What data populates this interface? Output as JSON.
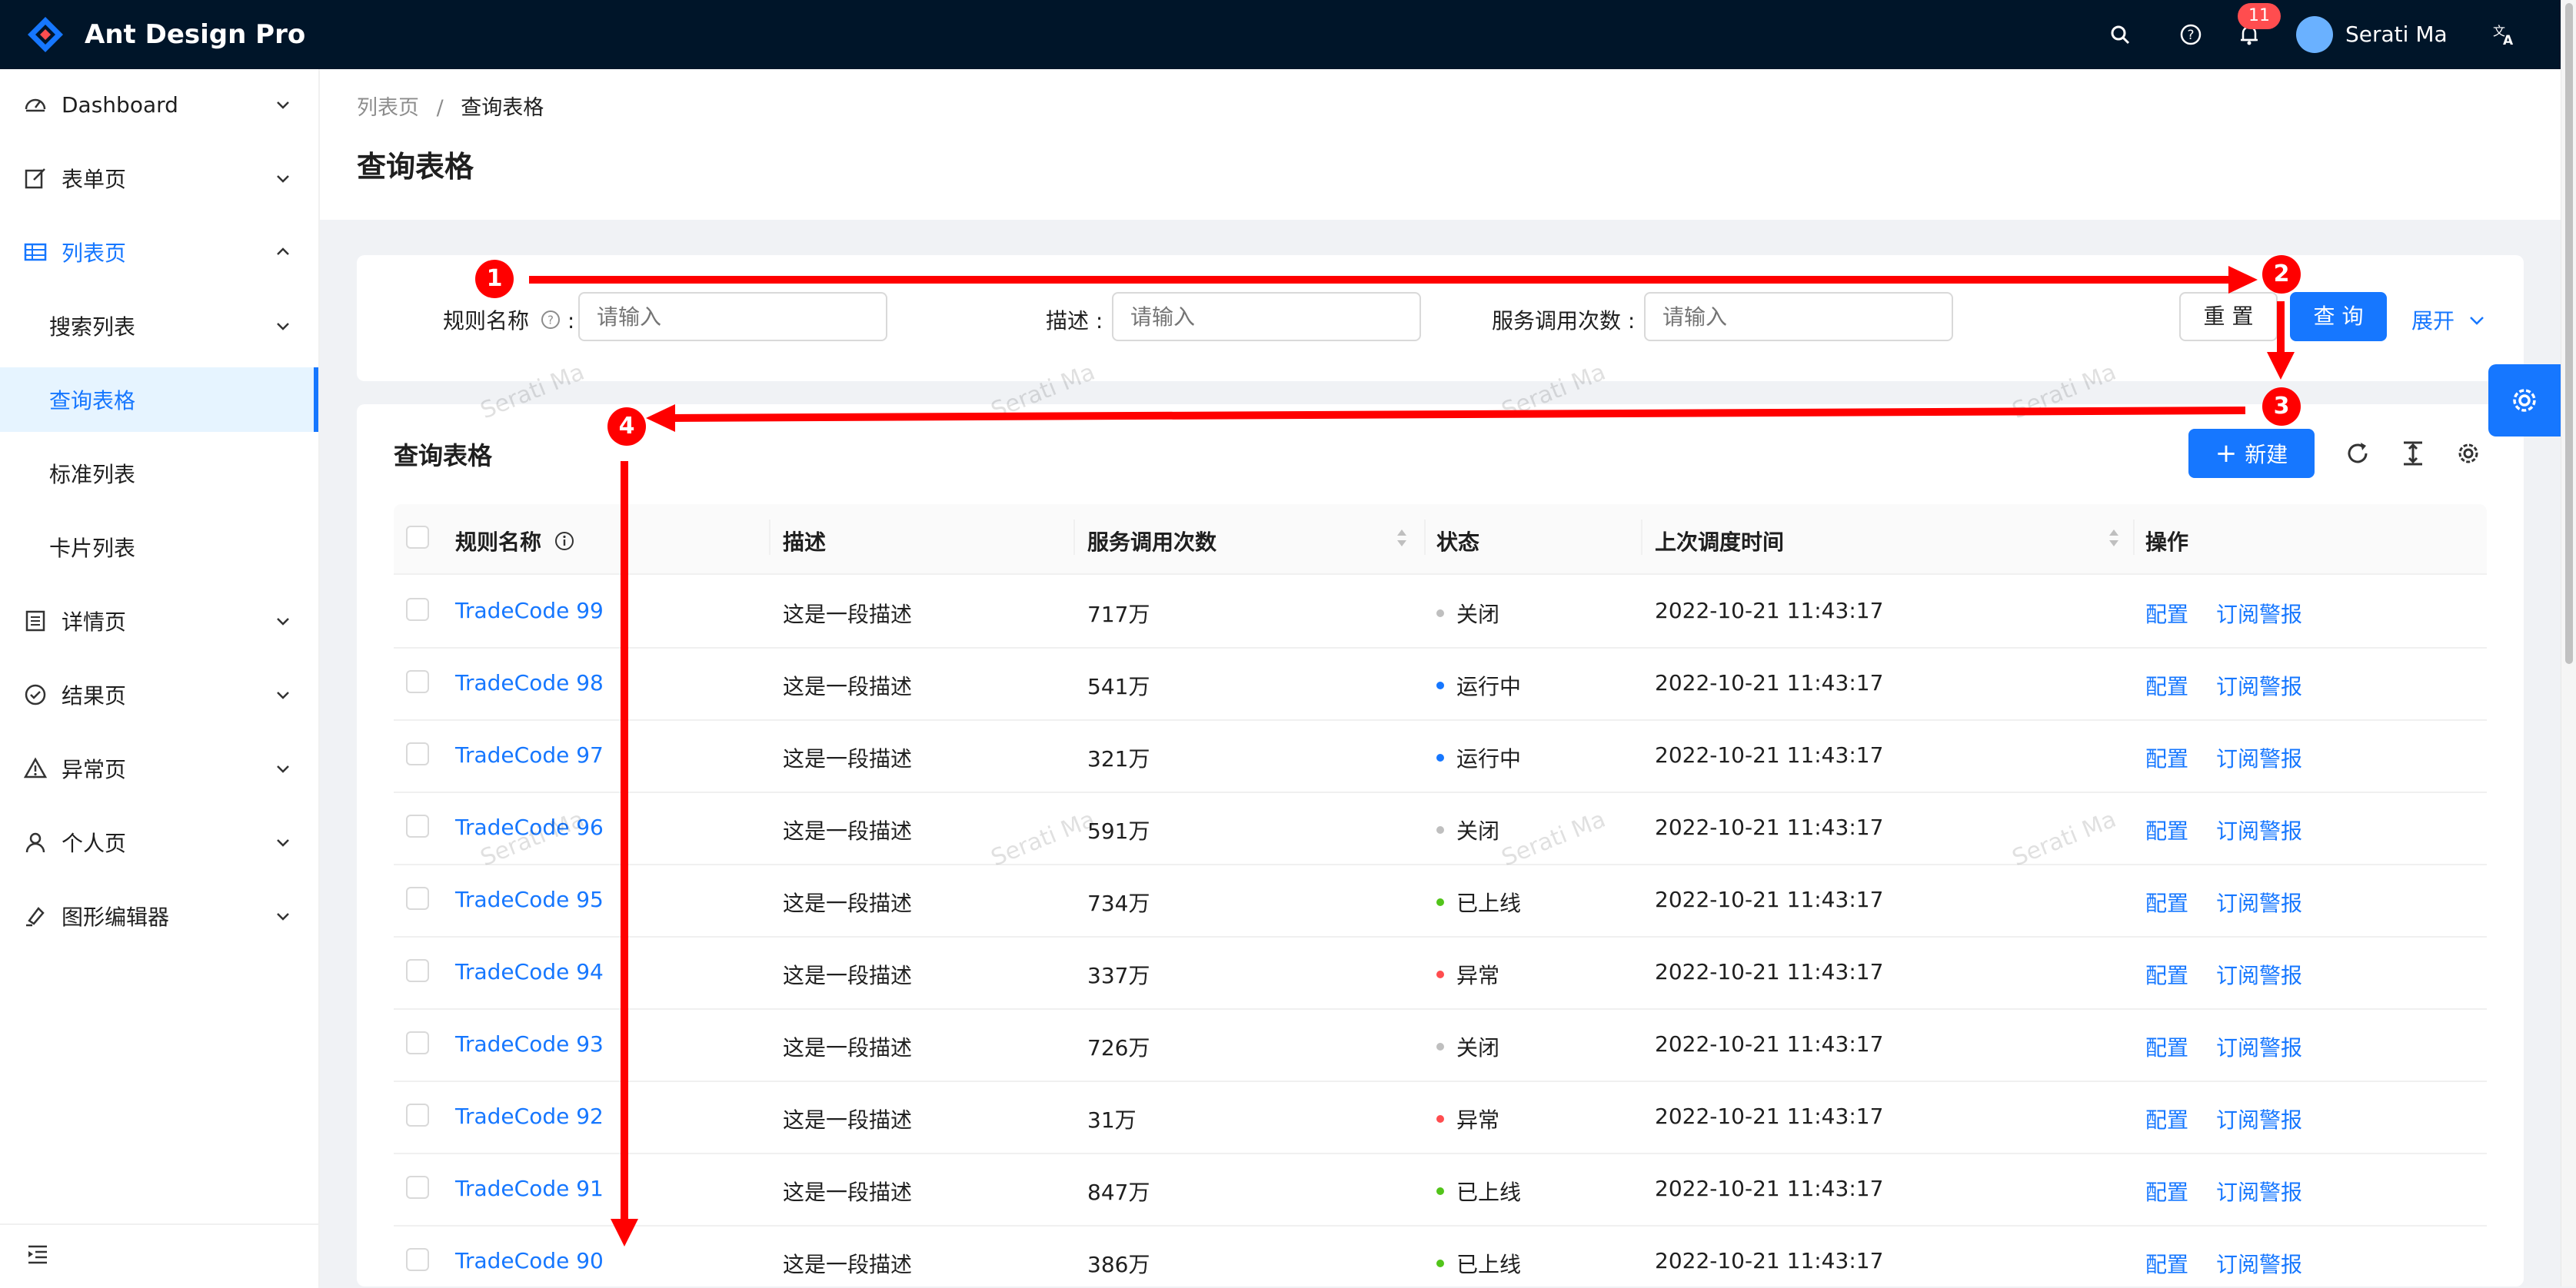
{
  "header": {
    "app_title": "Ant Design Pro",
    "notification_count": "11",
    "username": "Serati Ma",
    "icons": [
      "search-icon",
      "question-icon",
      "bell-icon",
      "translate-icon"
    ]
  },
  "sidebar": {
    "items": [
      {
        "label": "Dashboard",
        "icon": "dashboard-icon"
      },
      {
        "label": "表单页",
        "icon": "form-icon"
      },
      {
        "label": "列表页",
        "icon": "table-icon"
      },
      {
        "label": "搜索列表"
      },
      {
        "label": "查询表格"
      },
      {
        "label": "标准列表"
      },
      {
        "label": "卡片列表"
      },
      {
        "label": "详情页",
        "icon": "profile-icon"
      },
      {
        "label": "结果页",
        "icon": "check-circle-icon"
      },
      {
        "label": "异常页",
        "icon": "warning-icon"
      },
      {
        "label": "个人页",
        "icon": "user-icon"
      },
      {
        "label": "图形编辑器",
        "icon": "highlight-icon"
      }
    ]
  },
  "breadcrumb": {
    "parent": "列表页",
    "separator": "/",
    "current": "查询表格"
  },
  "page": {
    "title": "查询表格"
  },
  "search": {
    "rule_name_label": "规则名称",
    "rule_name_colon": ":",
    "desc_label": "描述",
    "desc_colon": ":",
    "calls_label": "服务调用次数",
    "calls_colon": ":",
    "placeholder": "请输入",
    "reset_label": "重 置",
    "query_label": "查 询",
    "expand_label": "展开"
  },
  "table": {
    "title": "查询表格",
    "new_button": "新建",
    "columns": [
      "规则名称",
      "描述",
      "服务调用次数",
      "状态",
      "上次调度时间",
      "操作"
    ],
    "rows": [
      {
        "name": "TradeCode 99",
        "desc": "这是一段描述",
        "calls": "717万",
        "status": "关闭",
        "time": "2022-10-21 11:43:17"
      },
      {
        "name": "TradeCode 98",
        "desc": "这是一段描述",
        "calls": "541万",
        "status": "运行中",
        "time": "2022-10-21 11:43:17"
      },
      {
        "name": "TradeCode 97",
        "desc": "这是一段描述",
        "calls": "321万",
        "status": "运行中",
        "time": "2022-10-21 11:43:17"
      },
      {
        "name": "TradeCode 96",
        "desc": "这是一段描述",
        "calls": "591万",
        "status": "关闭",
        "time": "2022-10-21 11:43:17"
      },
      {
        "name": "TradeCode 95",
        "desc": "这是一段描述",
        "calls": "734万",
        "status": "已上线",
        "time": "2022-10-21 11:43:17"
      },
      {
        "name": "TradeCode 94",
        "desc": "这是一段描述",
        "calls": "337万",
        "status": "异常",
        "time": "2022-10-21 11:43:17"
      },
      {
        "name": "TradeCode 93",
        "desc": "这是一段描述",
        "calls": "726万",
        "status": "关闭",
        "time": "2022-10-21 11:43:17"
      },
      {
        "name": "TradeCode 92",
        "desc": "这是一段描述",
        "calls": "31万",
        "status": "异常",
        "time": "2022-10-21 11:43:17"
      },
      {
        "name": "TradeCode 91",
        "desc": "这是一段描述",
        "calls": "847万",
        "status": "已上线",
        "time": "2022-10-21 11:43:17"
      },
      {
        "name": "TradeCode 90",
        "desc": "这是一段描述",
        "calls": "386万",
        "status": "已上线",
        "time": "2022-10-21 11:43:17"
      }
    ],
    "action_config": "配置",
    "action_subscribe": "订阅警报",
    "status_colors": {
      "关闭": "#bfbfbf",
      "运行中": "#1677ff",
      "已上线": "#52c41a",
      "异常": "#ff4d4f"
    }
  },
  "watermark_text": "Serati Ma",
  "annotations": [
    "1",
    "2",
    "3",
    "4"
  ],
  "colors": {
    "primary": "#1677ff",
    "header_bg": "#001529",
    "annotation": "#ff0000"
  }
}
